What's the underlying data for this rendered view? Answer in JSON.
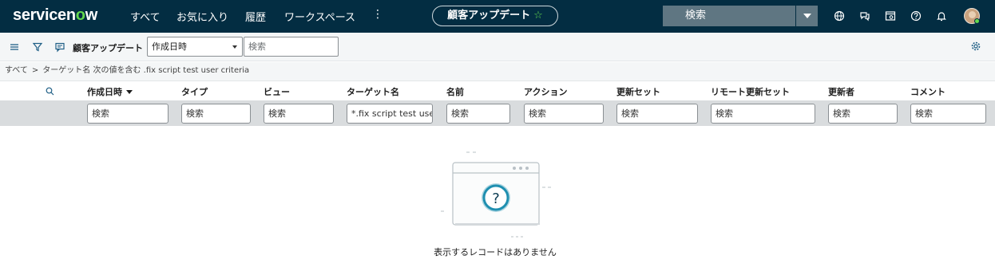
{
  "nav": {
    "logo_pre": "servicen",
    "logo_o": "o",
    "logo_post": "w",
    "links": [
      "すべて",
      "お気に入り",
      "履歴",
      "ワークスペース"
    ],
    "kebab": "⋮",
    "context_pill": "顧客アップデート",
    "pill_star": "☆",
    "search_placeholder": "検索"
  },
  "listbar": {
    "title": "顧客アップデート",
    "select_value": "作成日時",
    "search_placeholder": "検索"
  },
  "breadcrumb": {
    "root": "すべて",
    "sep": ">",
    "condition": "ターゲット名 次の値を含む .fix script test user criteria"
  },
  "columns": [
    "作成日時",
    "タイプ",
    "ビュー",
    "ターゲット名",
    "名前",
    "アクション",
    "更新セット",
    "リモート更新セット",
    "更新者",
    "コメント"
  ],
  "filters": [
    "検索",
    "検索",
    "検索",
    "*.fix script test user",
    "検索",
    "検索",
    "検索",
    "検索",
    "検索",
    "検索"
  ],
  "empty": {
    "message": "表示するレコードはありません",
    "glyph": "?"
  },
  "colors": {
    "nav_bg": "#032d42",
    "accent": "#62d84e",
    "filter_bg": "#d9dcde",
    "illustration_teal": "#1f8fb0"
  }
}
